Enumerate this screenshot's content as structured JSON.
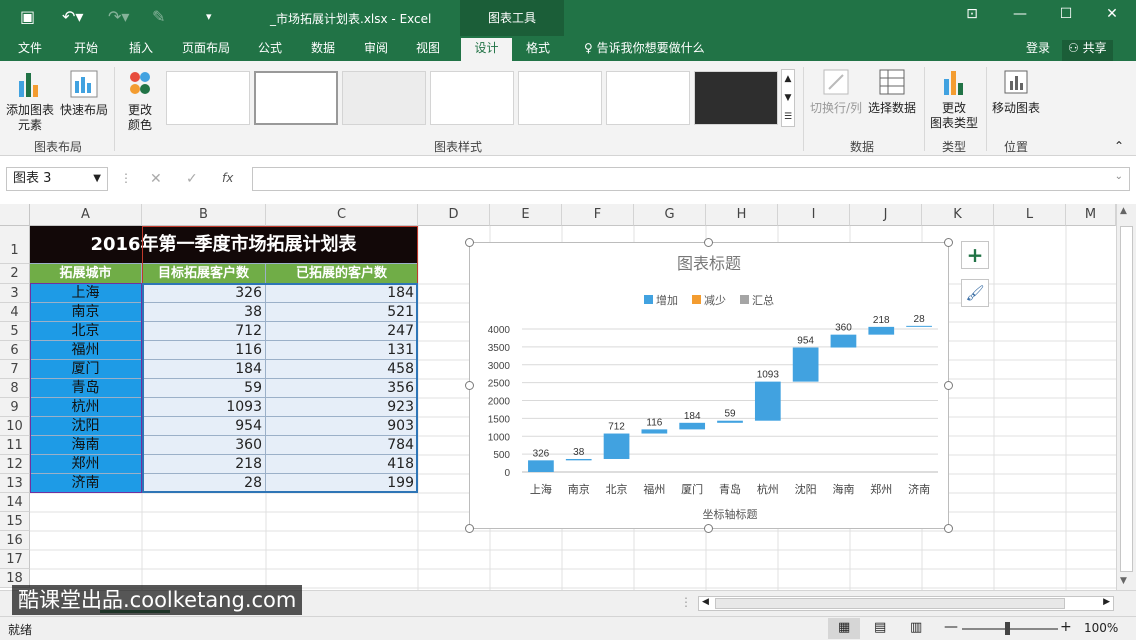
{
  "app": {
    "doc_title": "_市场拓展计划表.xlsx - Excel",
    "context_tab": "图表工具"
  },
  "tabs": [
    "文件",
    "开始",
    "插入",
    "页面布局",
    "公式",
    "数据",
    "审阅",
    "视图",
    "设计",
    "格式"
  ],
  "tell_me": "告诉我你想要做什么",
  "login": "登录",
  "share": "共享",
  "ribbon": {
    "add_element": "添加图表\n元素",
    "quick_layout": "快速布局",
    "change_color": "更改\n颜色",
    "switch_rowcol": "切换行/列",
    "select_data": "选择数据",
    "change_type": "更改\n图表类型",
    "move_chart": "移动图表",
    "groups": {
      "layout": "图表布局",
      "styles": "图表样式",
      "data": "数据",
      "type": "类型",
      "location": "位置"
    }
  },
  "namebox": "图表 3",
  "fx": "fx",
  "columns": [
    "A",
    "B",
    "C",
    "D",
    "E",
    "F",
    "G",
    "H",
    "I",
    "J",
    "K",
    "L",
    "M"
  ],
  "rows": [
    "1",
    "2",
    "3",
    "4",
    "5",
    "6",
    "7",
    "8",
    "9",
    "10",
    "11",
    "12",
    "13",
    "14",
    "15",
    "16",
    "17",
    "18"
  ],
  "table": {
    "title": "2016年第一季度市场拓展计划表",
    "headers": [
      "拓展城市",
      "目标拓展客户数",
      "已拓展的客户数"
    ],
    "data": [
      [
        "上海",
        "326",
        "184"
      ],
      [
        "南京",
        "38",
        "521"
      ],
      [
        "北京",
        "712",
        "247"
      ],
      [
        "福州",
        "116",
        "131"
      ],
      [
        "厦门",
        "184",
        "458"
      ],
      [
        "青岛",
        "59",
        "356"
      ],
      [
        "杭州",
        "1093",
        "923"
      ],
      [
        "沈阳",
        "954",
        "903"
      ],
      [
        "海南",
        "360",
        "784"
      ],
      [
        "郑州",
        "218",
        "418"
      ],
      [
        "济南",
        "28",
        "199"
      ]
    ]
  },
  "chart_data": {
    "type": "bar",
    "subtype": "waterfall",
    "title": "图表标题",
    "xlabel": "坐标轴标题",
    "ylabel": "",
    "legend": [
      "增加",
      "减少",
      "汇总"
    ],
    "legend_position": "top",
    "categories": [
      "上海",
      "南京",
      "北京",
      "福州",
      "厦门",
      "青岛",
      "杭州",
      "沈阳",
      "海南",
      "郑州",
      "济南"
    ],
    "values": [
      326,
      38,
      712,
      116,
      184,
      59,
      1093,
      954,
      360,
      218,
      28
    ],
    "yticks": [
      "0",
      "500",
      "1000",
      "1500",
      "2000",
      "2500",
      "3000",
      "3500",
      "4000"
    ],
    "ylim": [
      0,
      4000
    ],
    "grid": true,
    "colors": {
      "increase": "#41a2e0",
      "decrease": "#f39c30",
      "total": "#a5a5a5"
    }
  },
  "sheetbar": {
    "hscroll": ""
  },
  "status": {
    "ready": "就绪",
    "zoom": "100%"
  },
  "watermark": "酷课堂出品.coolketang.com"
}
